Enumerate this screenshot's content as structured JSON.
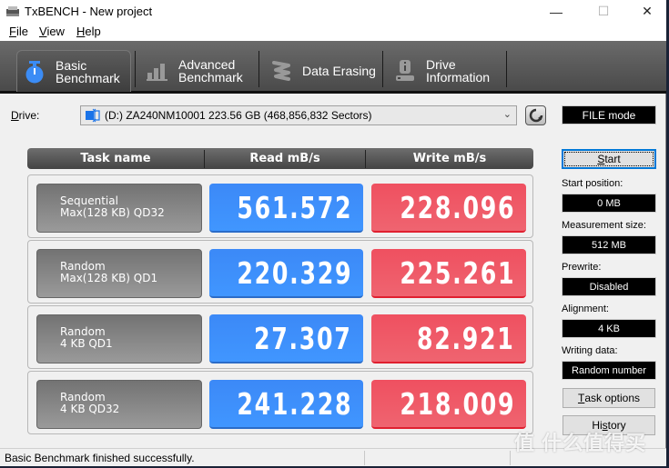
{
  "window": {
    "title": "TxBENCH - New project",
    "controls": {
      "minimize": "—",
      "maximize": "☐",
      "close": "✕"
    }
  },
  "menu": [
    {
      "accel": "F",
      "rest": "ile"
    },
    {
      "accel": "V",
      "rest": "iew"
    },
    {
      "accel": "H",
      "rest": "elp"
    }
  ],
  "tabs": [
    {
      "line1": "Basic",
      "line2": "Benchmark",
      "icon": "stopwatch-icon",
      "active": true
    },
    {
      "line1": "Advanced",
      "line2": "Benchmark",
      "icon": "bar-chart-icon",
      "active": false
    },
    {
      "line1": "Data Erasing",
      "line2": "",
      "icon": "eraser-icon",
      "active": false
    },
    {
      "line1": "Drive",
      "line2": "Information",
      "icon": "drive-info-icon",
      "active": false
    }
  ],
  "drive": {
    "label_accel": "D",
    "label_rest": "rive:",
    "selected": "(D:) ZA240NM10001  223.56 GB (468,856,832 Sectors)",
    "mode": "FILE mode"
  },
  "table": {
    "headers": [
      "Task name",
      "Read mB/s",
      "Write mB/s"
    ],
    "rows": [
      {
        "task_line1": "Sequential",
        "task_line2": "Max(128 KB) QD32",
        "read": "561.572",
        "write": "228.096"
      },
      {
        "task_line1": "Random",
        "task_line2": "Max(128 KB) QD1",
        "read": "220.329",
        "write": "225.261"
      },
      {
        "task_line1": "Random",
        "task_line2": "4 KB QD1",
        "read": "27.307",
        "write": "82.921"
      },
      {
        "task_line1": "Random",
        "task_line2": "4 KB QD32",
        "read": "241.228",
        "write": "218.009"
      }
    ]
  },
  "panel": {
    "start_accel": "S",
    "start_rest": "tart",
    "fields": [
      {
        "label": "Start position:",
        "value": "0 MB"
      },
      {
        "label": "Measurement size:",
        "value": "512 MB"
      },
      {
        "label": "Prewrite:",
        "value": "Disabled"
      },
      {
        "label": "Alignment:",
        "value": "4 KB"
      },
      {
        "label": "Writing data:",
        "value": "Random number"
      }
    ],
    "task_options_accel": "T",
    "task_options_rest": "ask options",
    "history_pre": "Hi",
    "history_accel": "s",
    "history_rest": "tory"
  },
  "status": {
    "text": "Basic Benchmark finished successfully."
  },
  "watermark": "值 什么值得买",
  "colors": {
    "read": "#4090ff",
    "write": "#ef5a68",
    "accent": "#0078d7"
  }
}
